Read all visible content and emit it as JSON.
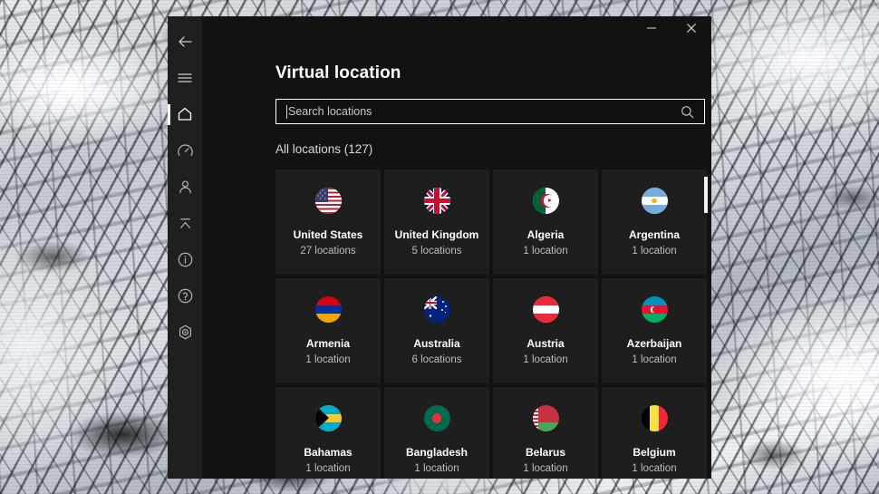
{
  "window": {
    "title": "Virtual location",
    "controls": [
      {
        "name": "minimize-button",
        "glyph": "minimize-icon"
      },
      {
        "name": "close-button",
        "glyph": "close-icon"
      }
    ]
  },
  "sidebar": {
    "items": [
      {
        "label": "Back",
        "icon": "back-arrow-icon",
        "selected": false
      },
      {
        "label": "Menu",
        "icon": "hamburger-menu-icon",
        "selected": false
      },
      {
        "label": "Home",
        "icon": "home-icon",
        "selected": true
      },
      {
        "label": "Speed test",
        "icon": "speedometer-icon",
        "selected": false
      },
      {
        "label": "Account",
        "icon": "person-icon",
        "selected": false
      },
      {
        "label": "Split tunneling",
        "icon": "split-tunneling-icon",
        "selected": false
      },
      {
        "label": "Information",
        "icon": "info-circle-icon",
        "selected": false
      },
      {
        "label": "Help",
        "icon": "question-circle-icon",
        "selected": false
      },
      {
        "label": "Settings",
        "icon": "settings-hex-icon",
        "selected": false
      }
    ]
  },
  "search": {
    "placeholder": "Search locations",
    "value": "",
    "icon": "search-icon"
  },
  "main": {
    "section_label": "All locations (127)",
    "total_locations": 127,
    "tiles": [
      {
        "country": "United States",
        "count_label": "27 locations",
        "flag": "us"
      },
      {
        "country": "United Kingdom",
        "count_label": "5 locations",
        "flag": "gb"
      },
      {
        "country": "Algeria",
        "count_label": "1 location",
        "flag": "dz"
      },
      {
        "country": "Argentina",
        "count_label": "1 location",
        "flag": "ar"
      },
      {
        "country": "Armenia",
        "count_label": "1 location",
        "flag": "am"
      },
      {
        "country": "Australia",
        "count_label": "6 locations",
        "flag": "au"
      },
      {
        "country": "Austria",
        "count_label": "1 location",
        "flag": "at"
      },
      {
        "country": "Azerbaijan",
        "count_label": "1 location",
        "flag": "az"
      },
      {
        "country": "Bahamas",
        "count_label": "1 location",
        "flag": "bs"
      },
      {
        "country": "Bangladesh",
        "count_label": "1 location",
        "flag": "bd"
      },
      {
        "country": "Belarus",
        "count_label": "1 location",
        "flag": "by"
      },
      {
        "country": "Belgium",
        "count_label": "1 location",
        "flag": "be"
      }
    ]
  },
  "colors": {
    "window_bg": "#121212",
    "sidebar_bg": "#1f1f1f",
    "tile_bg": "#1e1e1e",
    "accent": "#ffffff",
    "text_primary": "#ffffff",
    "text_secondary": "#bdbdbd"
  }
}
